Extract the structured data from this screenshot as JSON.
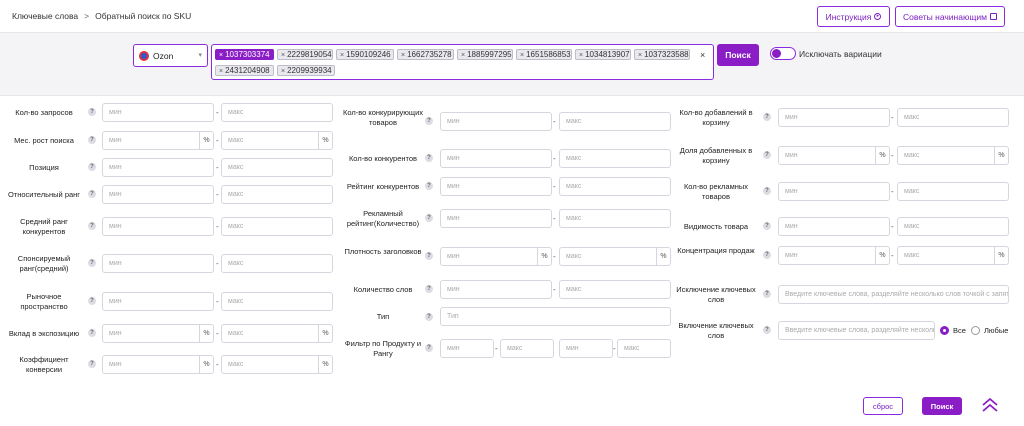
{
  "breadcrumb": {
    "root": "Ключевые слова",
    "separator": ">",
    "current": "Обратный поиск по SKU"
  },
  "header": {
    "instruction_label": "Инструкция",
    "tips_label": "Советы начинающим"
  },
  "search": {
    "platform": "Ozon",
    "tags": [
      "1037303374",
      "2229819054",
      "1590109246",
      "1662735278",
      "1885997295",
      "1651586853",
      "1034813907",
      "1037323588",
      "2431204908",
      "2209939934"
    ],
    "active_tag_index": 0,
    "clear_symbol": "×",
    "search_label": "Поиск",
    "exclude_variations_label": "Исключать вариации",
    "exclude_variations_on": false
  },
  "placeholders": {
    "min": "мин",
    "max": "макс",
    "type": "Тип",
    "keywords_exclude": "Введите ключевые слова, разделяйте несколько слов точкой с запятой",
    "keywords_include": "Введите ключевые слова, разделяйте несколько слов точкой с запятой",
    "percent": "%"
  },
  "columns": {
    "left": [
      {
        "label": "Кол-во запросов",
        "pct": false
      },
      {
        "label": "Мес. рост поиска",
        "pct": true
      },
      {
        "label": "Позиция",
        "pct": false
      },
      {
        "label": "Относительный ранг",
        "pct": false
      },
      {
        "label": "Средний ранг конкурентов",
        "pct": false
      },
      {
        "label": "Спонсируемый ранг(средний)",
        "pct": false
      },
      {
        "label": "Рыночное пространство",
        "pct": false
      },
      {
        "label": "Вклад в экспозицию",
        "pct": true
      },
      {
        "label": "Коэффициент конверсии",
        "pct": true
      }
    ],
    "middle": [
      {
        "label": "Кол-во конкурирующих товаров",
        "pct": false
      },
      {
        "label": "Кол-во конкурентов",
        "pct": false
      },
      {
        "label": "Рейтинг конкурентов",
        "pct": false
      },
      {
        "label": "Рекламный рейтинг(Количество)",
        "pct": false
      },
      {
        "label": "Плотность заголовков",
        "pct": true
      },
      {
        "label": "Количество слов",
        "pct": false
      },
      {
        "label": "Тип"
      },
      {
        "label": "Фильтр по Продукту и Рангу"
      }
    ],
    "right": [
      {
        "label": "Кол-во добавлений в корзину",
        "pct": false
      },
      {
        "label": "Доля добавленных в корзину",
        "pct": true
      },
      {
        "label": "Кол-во рекламных товаров",
        "pct": false
      },
      {
        "label": "Видимость товара",
        "pct": false
      },
      {
        "label": "Концентрация продаж",
        "pct": true
      },
      {
        "label": "Исключение ключевых слов"
      },
      {
        "label": "Включение ключевых слов"
      }
    ]
  },
  "include_mode": {
    "all_label": "Все",
    "any_label": "Любые",
    "selected": "all"
  },
  "footer": {
    "reset_label": "сброс",
    "search_label": "Поиск"
  },
  "colors": {
    "accent": "#8a1dc6"
  }
}
